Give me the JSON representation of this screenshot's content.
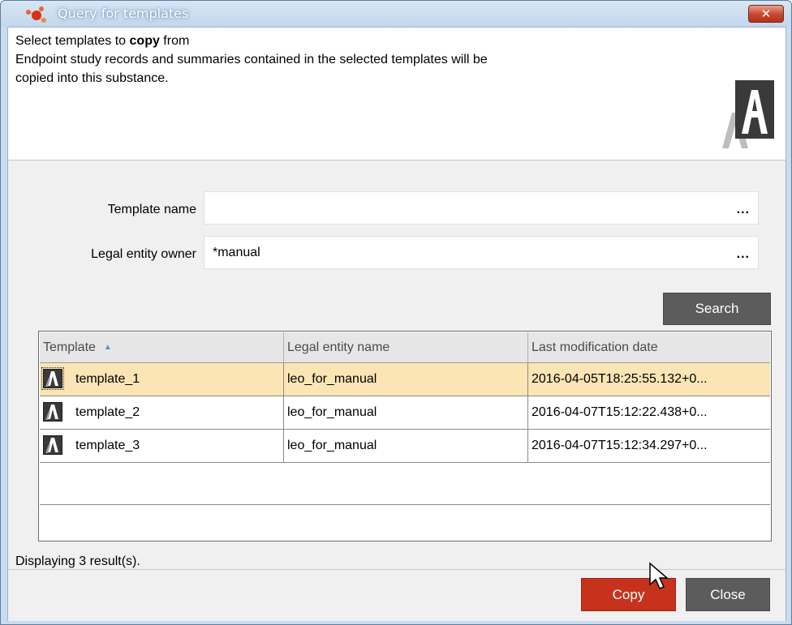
{
  "window": {
    "title": "Query for templates",
    "close_glyph": "✕",
    "app_icon": "molecule-icon"
  },
  "header": {
    "line1_prefix": "Select templates to ",
    "line1_bold": "copy",
    "line1_suffix": " from",
    "line2": "Endpoint study records and summaries contained in the selected templates will be",
    "line3": "copied into this substance.",
    "logo": "iuclid-logo-icon"
  },
  "form": {
    "template_name_label": "Template name",
    "template_name_value": "",
    "legal_entity_label": "Legal entity owner",
    "legal_entity_value": "*manual",
    "ellipsis": "..."
  },
  "search_label": "Search",
  "table": {
    "columns": [
      "Template",
      "Legal entity name",
      "Last modification date"
    ],
    "sort_indicator": "▲",
    "rows": [
      {
        "template": "template_1",
        "legal_entity": "leo_for_manual",
        "date": "2016-04-05T18:25:55.132+0...",
        "selected": true
      },
      {
        "template": "template_2",
        "legal_entity": "leo_for_manual",
        "date": "2016-04-07T15:12:22.438+0...",
        "selected": false
      },
      {
        "template": "template_3",
        "legal_entity": "leo_for_manual",
        "date": "2016-04-07T15:12:34.297+0...",
        "selected": false
      }
    ]
  },
  "status_text": "Displaying 3 result(s).",
  "footer": {
    "copy_label": "Copy",
    "close_label": "Close"
  },
  "colors": {
    "selected_row": "#fbe5b5",
    "copy_button": "#c6321c",
    "dark_button": "#5c5c5c"
  }
}
